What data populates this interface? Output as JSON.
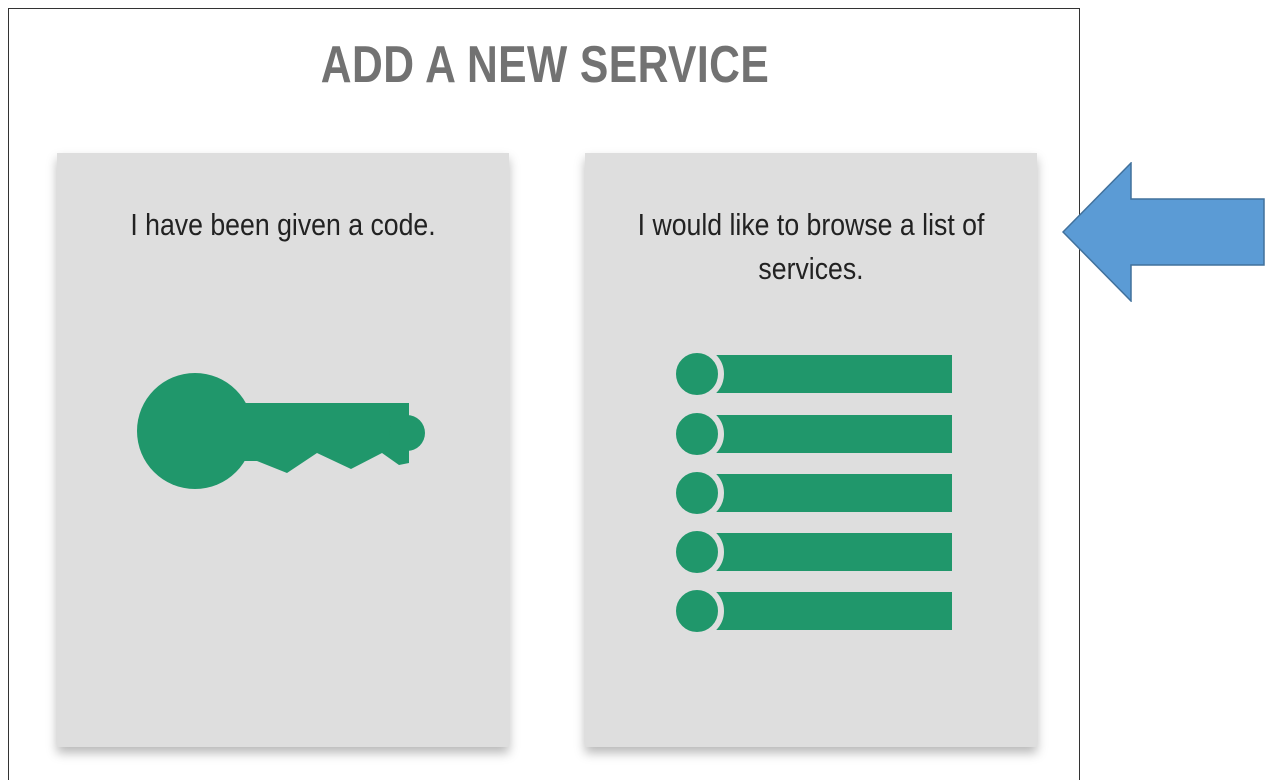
{
  "page": {
    "title": "ADD A NEW SERVICE"
  },
  "options": [
    {
      "label": "I have been given a code.",
      "icon": "key-icon"
    },
    {
      "label": "I would like to browse a list of services.",
      "icon": "list-icon"
    }
  ],
  "colors": {
    "accent": "#20976b",
    "card": "#dedede",
    "title": "#727272",
    "arrow_fill": "#5b9bd5",
    "arrow_stroke": "#41719c"
  },
  "annotation": {
    "icon": "left-arrow-icon"
  }
}
